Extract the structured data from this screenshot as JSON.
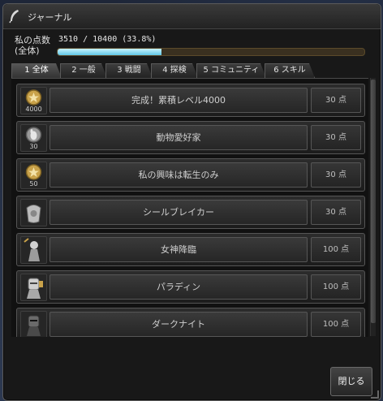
{
  "window": {
    "title": "ジャーナル"
  },
  "score": {
    "label_line1": "私の点数",
    "label_line2": "(全体)",
    "value_text": "3510 / 10400 (33.8%)",
    "progress": 0.338
  },
  "tabs": [
    {
      "label": "1 全体",
      "active": true
    },
    {
      "label": "2 一般",
      "active": false
    },
    {
      "label": "3 戦闘",
      "active": false
    },
    {
      "label": "4 探検",
      "active": false
    },
    {
      "label": "5 コミュニティ",
      "active": false
    },
    {
      "label": "6 スキル",
      "active": false
    }
  ],
  "achievements": [
    {
      "name": "完成！累積レベル4000",
      "points": "30 点",
      "icon": "star-medal-icon",
      "icon_number": "4000"
    },
    {
      "name": "動物愛好家",
      "points": "30 点",
      "icon": "animal-lover-icon",
      "icon_number": "30"
    },
    {
      "name": "私の興味は転生のみ",
      "points": "30 点",
      "icon": "star-medal-icon",
      "icon_number": "50"
    },
    {
      "name": "シールブレイカー",
      "points": "30 点",
      "icon": "seal-breaker-icon",
      "icon_number": ""
    },
    {
      "name": "女神降臨",
      "points": "100 点",
      "icon": "goddess-icon",
      "icon_number": ""
    },
    {
      "name": "パラディン",
      "points": "100 点",
      "icon": "paladin-icon",
      "icon_number": ""
    },
    {
      "name": "ダークナイト",
      "points": "100 点",
      "icon": "dark-knight-icon",
      "icon_number": ""
    }
  ],
  "buttons": {
    "close_label": "閉じる"
  },
  "colors": {
    "progress_fill": "#5fc6e6",
    "medal_gold": "#c9a24a"
  }
}
